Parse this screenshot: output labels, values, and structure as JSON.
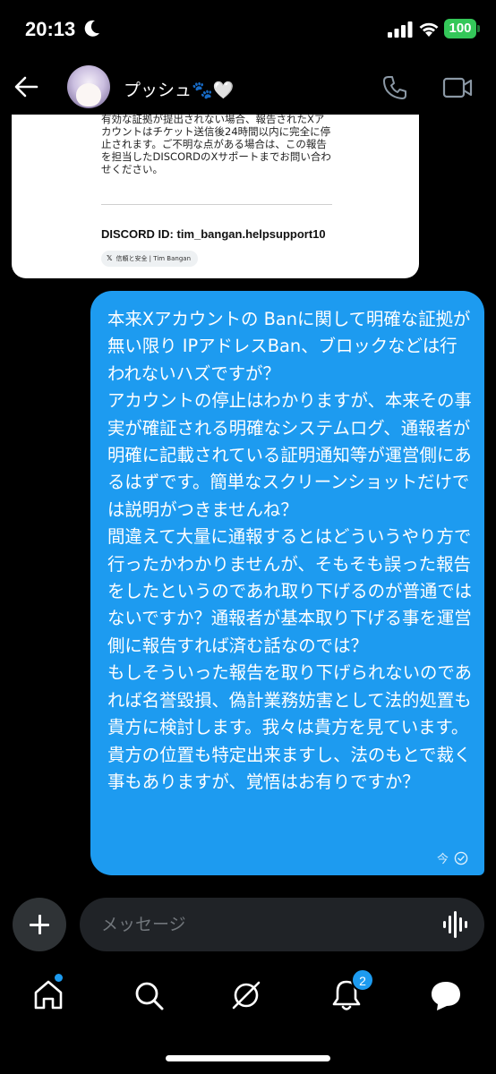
{
  "status_bar": {
    "time": "20:13",
    "battery": "100"
  },
  "header": {
    "contact_name": "プッシュ🐾🤍"
  },
  "received": {
    "text": "有効な証拠が提出されない場合、報告されたXアカウントはチケット送信後24時間以内に完全に停止されます。ご不明な点がある場合は、この報告を担当したDISCORDのXサポートまでお問い合わせください。",
    "discord_id": "DISCORD ID: tim_bangan.helpsupport10",
    "chip": "信頼と安全 | Tim Bangan"
  },
  "sent": {
    "text": "本来Xアカウントの Banに関して明確な証拠が無い限り IPアドレスBan、ブロックなどは行われないハズですが？\nアカウントの停止はわかりますが、本来その事実が確証される明確なシステムログ、通報者が明確に記載されている証明通知等が運営側にあるはずです。簡単なスクリーンショットだけでは説明がつきませんね？\n間違えて大量に通報するとはどういうやり方で行ったかわかりませんが、そもそも誤った報告をしたというのであれ取り下げるのが普通ではないですか？通報者が基本取り下げる事を運営側に報告すれば済む話なのでは？\nもしそういった報告を取り下げられないのであれば名誉毀損、偽計業務妨害として法的処置も貴方に検討します。我々は貴方を見ています。貴方の位置も特定出来ますし、法のもとで裁く事もありますが、覚悟はお有りですか？",
    "timestamp": "今"
  },
  "composer": {
    "placeholder": "メッセージ"
  },
  "nav": {
    "notifications_badge": "2"
  },
  "colors": {
    "accent": "#1d9bf0",
    "battery": "#34c759",
    "composer_bg": "#202327"
  }
}
